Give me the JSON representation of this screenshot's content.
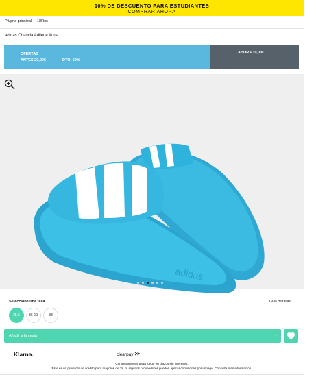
{
  "promo": {
    "line1": "10% DE DESCUENTO PARA ESTUDIANTES",
    "line2": "COMPRAR AHORA"
  },
  "breadcrumb": {
    "home": "Página principal",
    "separator": "›",
    "current": "18Ros"
  },
  "product": {
    "name": "adidas Chancla Adilette Aqua"
  },
  "price": {
    "offers_label": "OFERTAS",
    "before": "ANTES 20,00€",
    "discount": "DTO. 50%",
    "now": "AHORA 10,00€"
  },
  "gallery": {
    "image_alt": "Sandalias azules con tres franjas blancas",
    "dots": 6,
    "active_dot": 2
  },
  "sizes": {
    "title": "Seleccione una talla",
    "guide": "Guía de tallas",
    "options": [
      "35.5",
      "36 2/3",
      "38"
    ],
    "selected": 0
  },
  "cart": {
    "add_label": "Añadir a la cesta",
    "arrow": "›"
  },
  "payment": {
    "klarna": "Klarna.",
    "clearpay": "clearpay",
    "note": "Compra ahora y paga luego en plazos sin intereses.",
    "credit_note": "Este es un producto de crédito para mayores de 18. m Algunos proveedores pueden aplicar comisiones por impago. Consulta más información."
  },
  "colors": {
    "promo": "#ffe600",
    "price_left": "#5ab8de",
    "price_right": "#566169",
    "accent": "#4fd5b0",
    "shoe": "#3bbbe2"
  }
}
